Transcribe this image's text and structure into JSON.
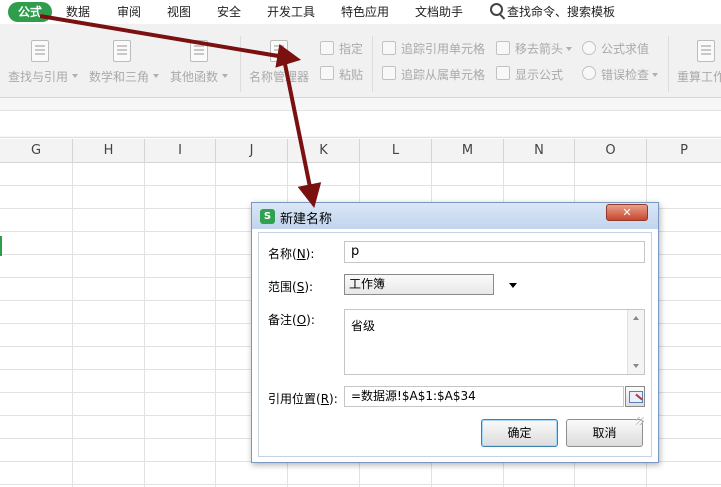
{
  "menu": {
    "active_tab": "公式",
    "tabs": [
      "数据",
      "审阅",
      "视图",
      "安全",
      "开发工具",
      "特色应用",
      "文档助手"
    ],
    "search_text": "查找命令、搜索模板"
  },
  "ribbon": {
    "lookup": "查找与引用",
    "math": "数学和三角",
    "other": "其他函数",
    "name_manager": "名称管理器",
    "assign": "指定",
    "paste": "粘贴",
    "trace_precedents": "追踪引用单元格",
    "trace_dependents": "追踪从属单元格",
    "remove_arrows": "移去箭头",
    "show_formulas": "显示公式",
    "evaluate": "公式求值",
    "error_check": "错误检查",
    "recalc": "重算工作"
  },
  "grid": {
    "columns": [
      "G",
      "H",
      "I",
      "J",
      "K",
      "L",
      "M",
      "N",
      "O",
      "P"
    ]
  },
  "dialog": {
    "title": "新建名称",
    "app_logo": "S",
    "close_glyph": "✕",
    "name": {
      "label_prefix": "名称(",
      "label_key": "N",
      "label_suffix": "):",
      "value": "p"
    },
    "scope": {
      "label_prefix": "范围(",
      "label_key": "S",
      "label_suffix": "):",
      "value": "工作簿"
    },
    "comment": {
      "label_prefix": "备注(",
      "label_key": "O",
      "label_suffix": "):",
      "value": "省级"
    },
    "refers_to": {
      "label_prefix": "引用位置(",
      "label_key": "R",
      "label_suffix": "):",
      "value": "=数据源!$A$1:$A$34"
    },
    "ok": "确定",
    "cancel": "取消"
  },
  "colors": {
    "accent": "#2e9e4c",
    "annotation_arrow": "#7b1010"
  }
}
